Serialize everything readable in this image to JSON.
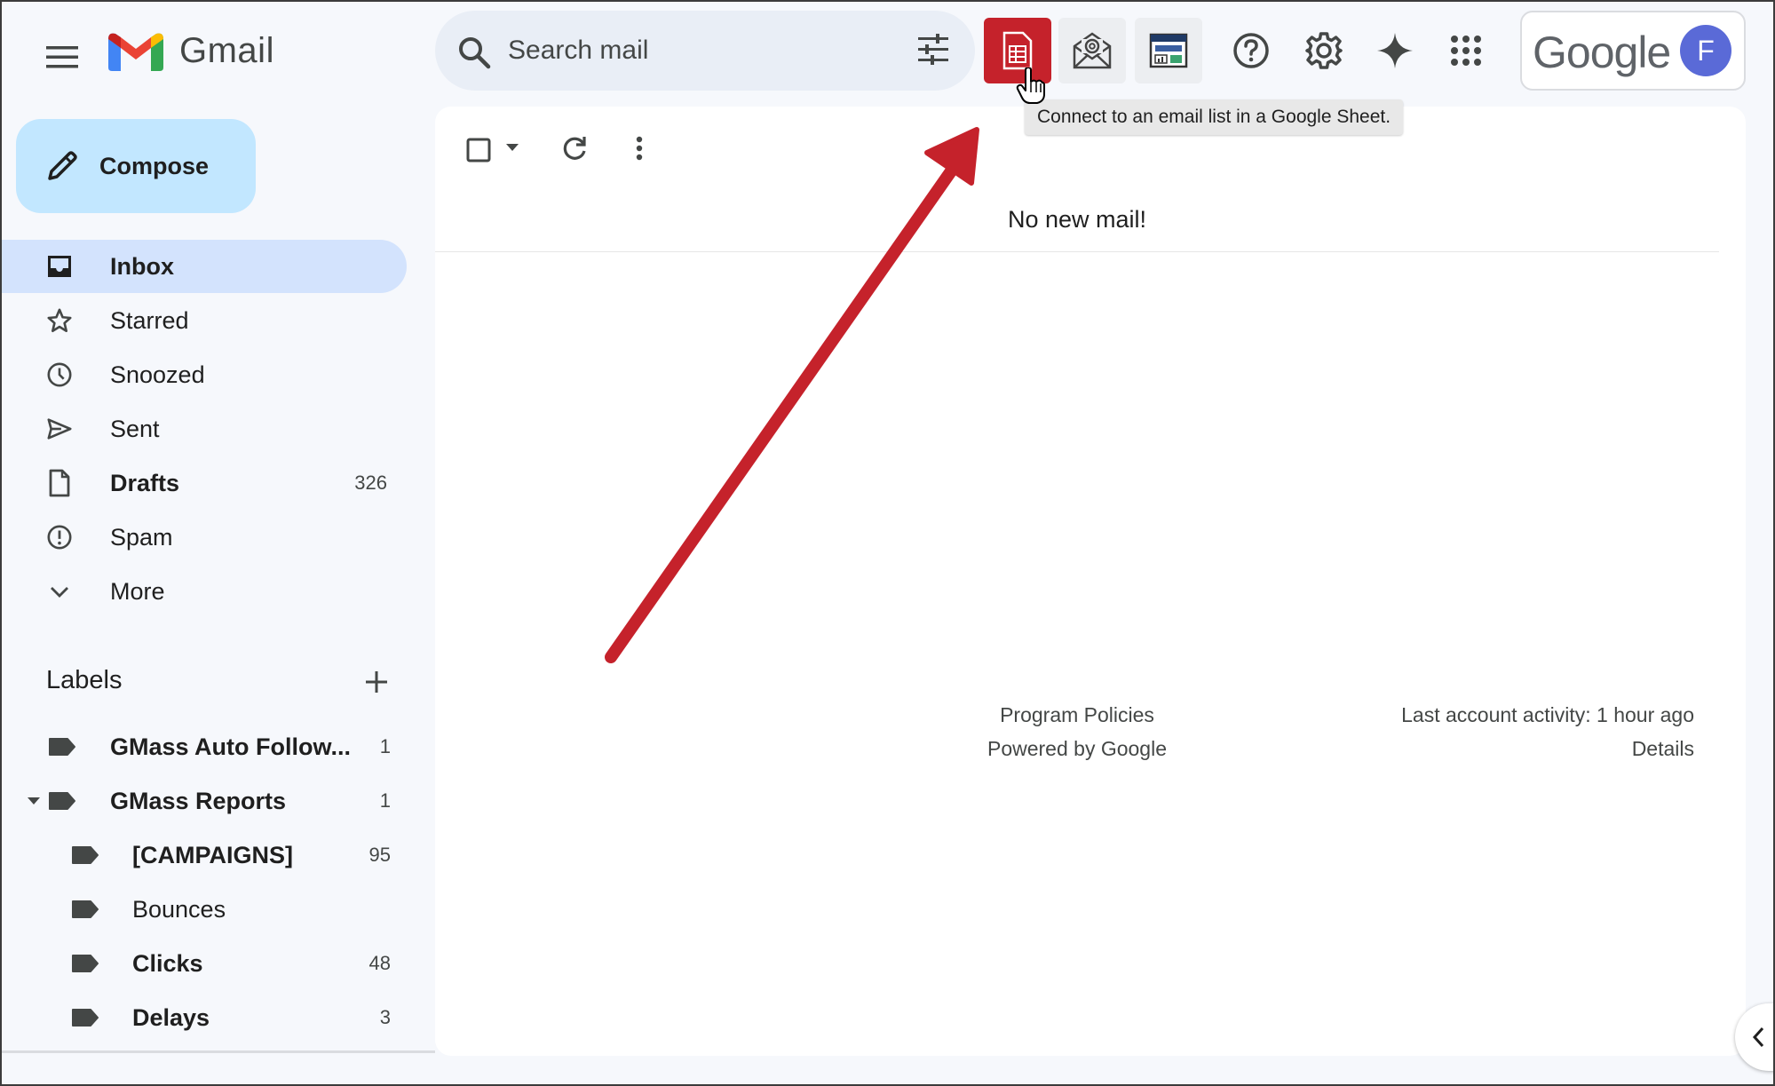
{
  "app": {
    "name": "Gmail",
    "account_initial": "F",
    "google_wordmark": "Google"
  },
  "colors": {
    "accent": "#c2e7ff",
    "active_nav": "#d3e3fd",
    "ext_sheet": "#c5222b",
    "arrow": "#c5222b",
    "avatar": "#5a6ad7"
  },
  "search": {
    "placeholder": "Search mail"
  },
  "toolbar_icons": [
    "menu-icon",
    "search-icon",
    "tune-icon",
    "sheet-icon",
    "mail-at-icon",
    "dashboard-icon",
    "help-icon",
    "gear-icon",
    "sparkle-icon",
    "apps-grid-icon"
  ],
  "compose": {
    "label": "Compose"
  },
  "nav": [
    {
      "label": "Inbox",
      "icon": "inbox-icon",
      "count": "",
      "bold": true,
      "active": true
    },
    {
      "label": "Starred",
      "icon": "star-icon",
      "count": ""
    },
    {
      "label": "Snoozed",
      "icon": "clock-icon",
      "count": ""
    },
    {
      "label": "Sent",
      "icon": "send-icon",
      "count": ""
    },
    {
      "label": "Drafts",
      "icon": "draft-icon",
      "count": "326",
      "bold": true
    },
    {
      "label": "Spam",
      "icon": "spam-icon",
      "count": ""
    },
    {
      "label": "More",
      "icon": "chevron-down-icon",
      "count": ""
    }
  ],
  "labels": {
    "title": "Labels",
    "items": [
      {
        "name": "GMass Auto Follow...",
        "count": "1",
        "bold": true
      },
      {
        "name": "GMass Reports",
        "count": "1",
        "bold": true
      },
      {
        "name": "[CAMPAIGNS]",
        "count": "95",
        "bold": true
      },
      {
        "name": "Bounces",
        "count": ""
      },
      {
        "name": "Clicks",
        "count": "48",
        "bold": true
      },
      {
        "name": "Delays",
        "count": "3",
        "bold": true
      }
    ]
  },
  "main": {
    "empty_message": "No new mail!",
    "footer": {
      "policies": "Program Policies",
      "powered": "Powered by Google",
      "activity": "Last account activity: 1 hour ago",
      "details": "Details"
    }
  },
  "tooltip": {
    "text": "Connect to an email list in a Google Sheet."
  }
}
